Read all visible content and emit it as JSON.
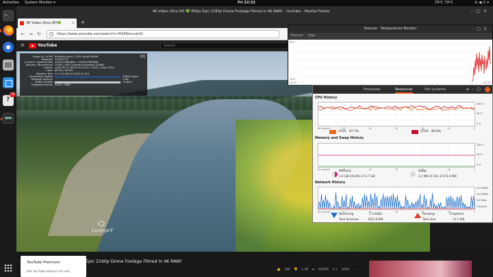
{
  "topbar": {
    "activities": "Activities",
    "app_menu": "System Monitor ▾",
    "clock": "Fri 22:32",
    "temps": "79°C 79°C"
  },
  "firefox": {
    "window_title": "4K Video Ultra HD 💚 60fps Epic 2160p Drone Footage Filmed In 4K RAW! - YouTube - Mozilla Firefox",
    "tab_title": "4K Video Ultra HD💚",
    "url": "https://www.youtube.com/watch?v=RSAKkscnjmQ"
  },
  "youtube": {
    "logo": "YouTube",
    "search_placeholder": "Search",
    "watermark": "LoungeV",
    "video_title": "s Epic 2160p Drone Footage Filmed In 4K RAW!",
    "likes": "39K",
    "dislikes": "1.4K",
    "share": "SHARE",
    "save": "SAVE",
    "premium_title": "YouTube Premium",
    "premium_sub": "Get YouTube without the ads."
  },
  "stats_for_nerds": [
    {
      "k": "Video ID / sCPN",
      "v": "RSAKkscnjmQ / 3F3L 6AAB 9DDB"
    },
    {
      "k": "Viewport",
      "v": "1274x713"
    },
    {
      "k": "Current / Optimal Res",
      "v": "1920x1080@60 / 1920x1080@60"
    },
    {
      "k": "Volume / Normalized",
      "v": "100% / 93% (content loudness 0.6dB)"
    },
    {
      "k": "Codecs",
      "v": "vp09.00.51.08.01.01.01.01 (303) / opus (251)"
    },
    {
      "k": "Color",
      "v": "bt709 / bt709"
    },
    {
      "k": "Mystery Text",
      "v": "s:4 t:22.08 b:0.000-41.101"
    },
    {
      "k": "Connection Speed",
      "v": "36492 Kbps"
    },
    {
      "k": "Network Activity",
      "v": "0 KB"
    },
    {
      "k": "Buffer Health",
      "v": "19.88 s"
    },
    {
      "k": "Dropped Frames",
      "v": "3429 / 7889"
    }
  ],
  "psensor": {
    "title": "Psensor - Temperature Monitor",
    "menu": [
      "Psensor",
      "Help"
    ],
    "y_top": "85°C",
    "y_bottom": "78°C",
    "x_left": "22:12",
    "x_right": "22:32"
  },
  "sysmon": {
    "tabs": [
      "Processes",
      "Resources",
      "File Systems"
    ],
    "active_tab": "Resources",
    "cpu": {
      "title": "CPU History",
      "cpu1_label": "CPU1",
      "cpu1_value": "87.5%",
      "cpu2_label": "CPU2",
      "cpu2_value": "80.8%",
      "cpu1_color": "#e66a1a",
      "cpu2_color": "#c0122c",
      "y_ticks": [
        "100 %",
        "50 %",
        "0 %"
      ],
      "x_ticks": [
        "60 seconds",
        "50",
        "40",
        "30",
        "20",
        "10",
        "0"
      ]
    },
    "memory": {
      "title": "Memory and Swap History",
      "mem_label": "Memory",
      "mem_value": "1.8 GiB (48.8%) of 3.7 GiB",
      "swap_label": "Swap",
      "swap_value": "2.2 MiB (0.5%) of 472.6 MiB",
      "mem_color": "#c4236b",
      "swap_color": "#4caf50",
      "y_ticks": [
        "100 %",
        "50 %",
        "0 %"
      ],
      "x_ticks": [
        "60 seconds",
        "50",
        "40",
        "30",
        "20",
        "10",
        "0"
      ]
    },
    "network": {
      "title": "Network History",
      "recv_label": "Receiving",
      "recv_total_label": "Total Received",
      "recv_rate": "1.3 KiB/s",
      "recv_total": "1022.8 MiB",
      "send_label": "Sending",
      "send_total_label": "Total Sent",
      "send_rate": "0 bytes/s",
      "send_total": "14.1 MiB",
      "recv_color": "#1f6fc9",
      "send_color": "#e03a2a",
      "y_ticks": [
        "15.0 MiB/s",
        "10.0 MiB/s",
        "5.0 MiB/s",
        "0 bytes/s"
      ],
      "x_ticks": [
        "60 seconds",
        "50",
        "40",
        "30",
        "20",
        "10",
        "0"
      ]
    }
  }
}
